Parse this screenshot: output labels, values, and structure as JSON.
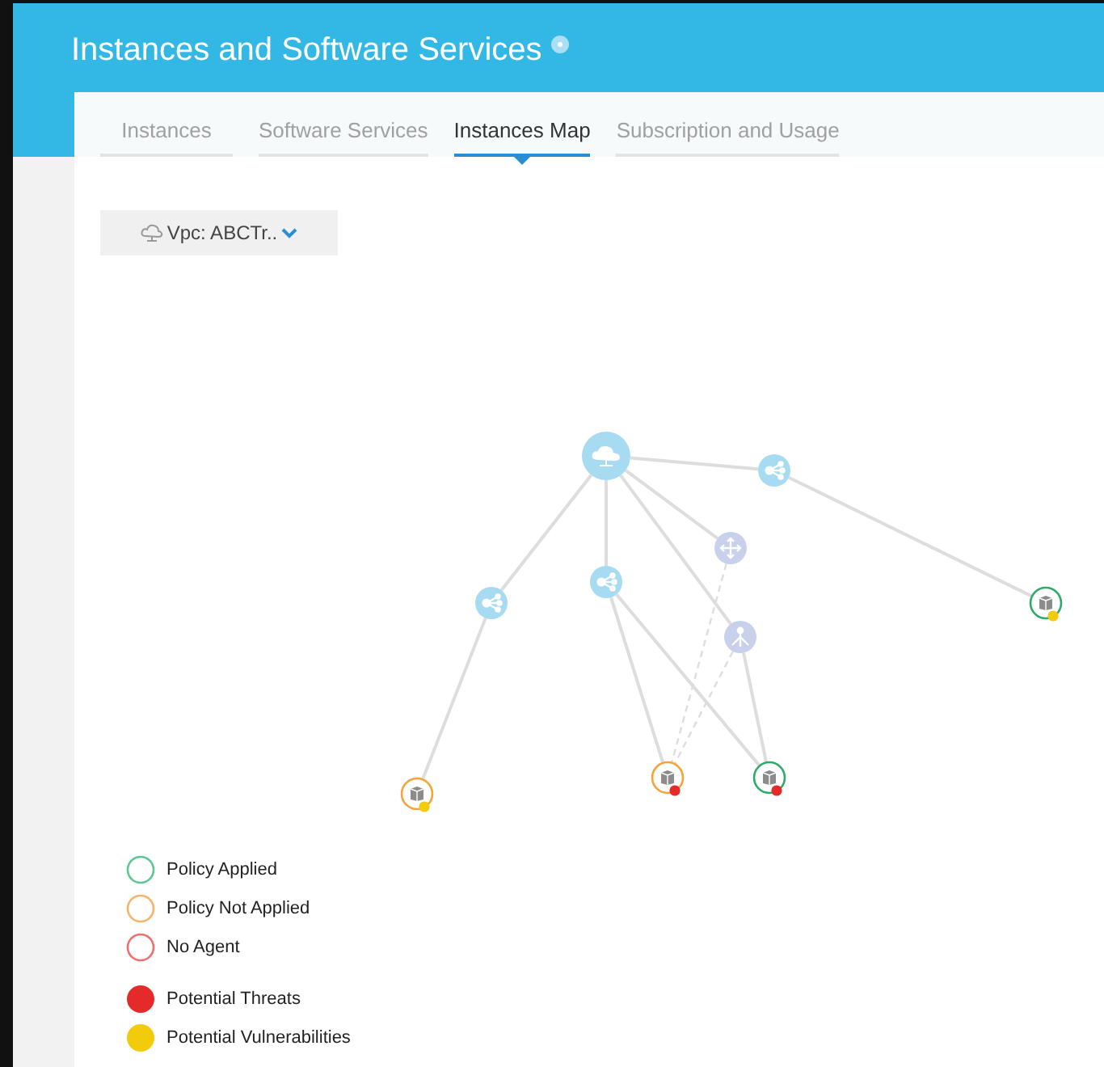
{
  "header": {
    "title": "Instances and Software Services"
  },
  "tabs": [
    {
      "label": "Instances",
      "selected": false
    },
    {
      "label": "Software Services",
      "selected": false
    },
    {
      "label": "Instances Map",
      "selected": true
    },
    {
      "label": "Subscription and Usage",
      "selected": false
    }
  ],
  "vpc_dropdown": {
    "value": "Vpc: ABCTr.."
  },
  "map": {
    "nodes": [
      {
        "kind": "cloud"
      },
      {
        "kind": "hub"
      },
      {
        "kind": "router"
      },
      {
        "kind": "hub"
      },
      {
        "kind": "hub"
      },
      {
        "kind": "balancer"
      },
      {
        "kind": "instance",
        "color": "#f5a33a",
        "badge": {
          "color": "#f2cc0c"
        }
      },
      {
        "kind": "instance",
        "color": "#f5a33a",
        "badge": {
          "color": "#e52a2a"
        }
      },
      {
        "kind": "instance",
        "color": "#2eab6b",
        "badge": {
          "color": "#e52a2a"
        }
      },
      {
        "kind": "instance",
        "color": "#2eab6b",
        "badge": {
          "color": "#f2cc0c"
        }
      }
    ]
  },
  "legend": [
    {
      "kind": "ring",
      "label": "Policy Applied",
      "color": "#5cc795"
    },
    {
      "kind": "ring",
      "label": "Policy Not Applied",
      "color": "#f7b36a"
    },
    {
      "kind": "ring",
      "label": "No Agent",
      "color": "#ef6f6f"
    },
    {
      "kind": "dot",
      "label": "Potential Threats",
      "color": "#e52a2a"
    },
    {
      "kind": "dot",
      "label": "Potential Vulnerabilities",
      "color": "#f2cc0c"
    }
  ]
}
